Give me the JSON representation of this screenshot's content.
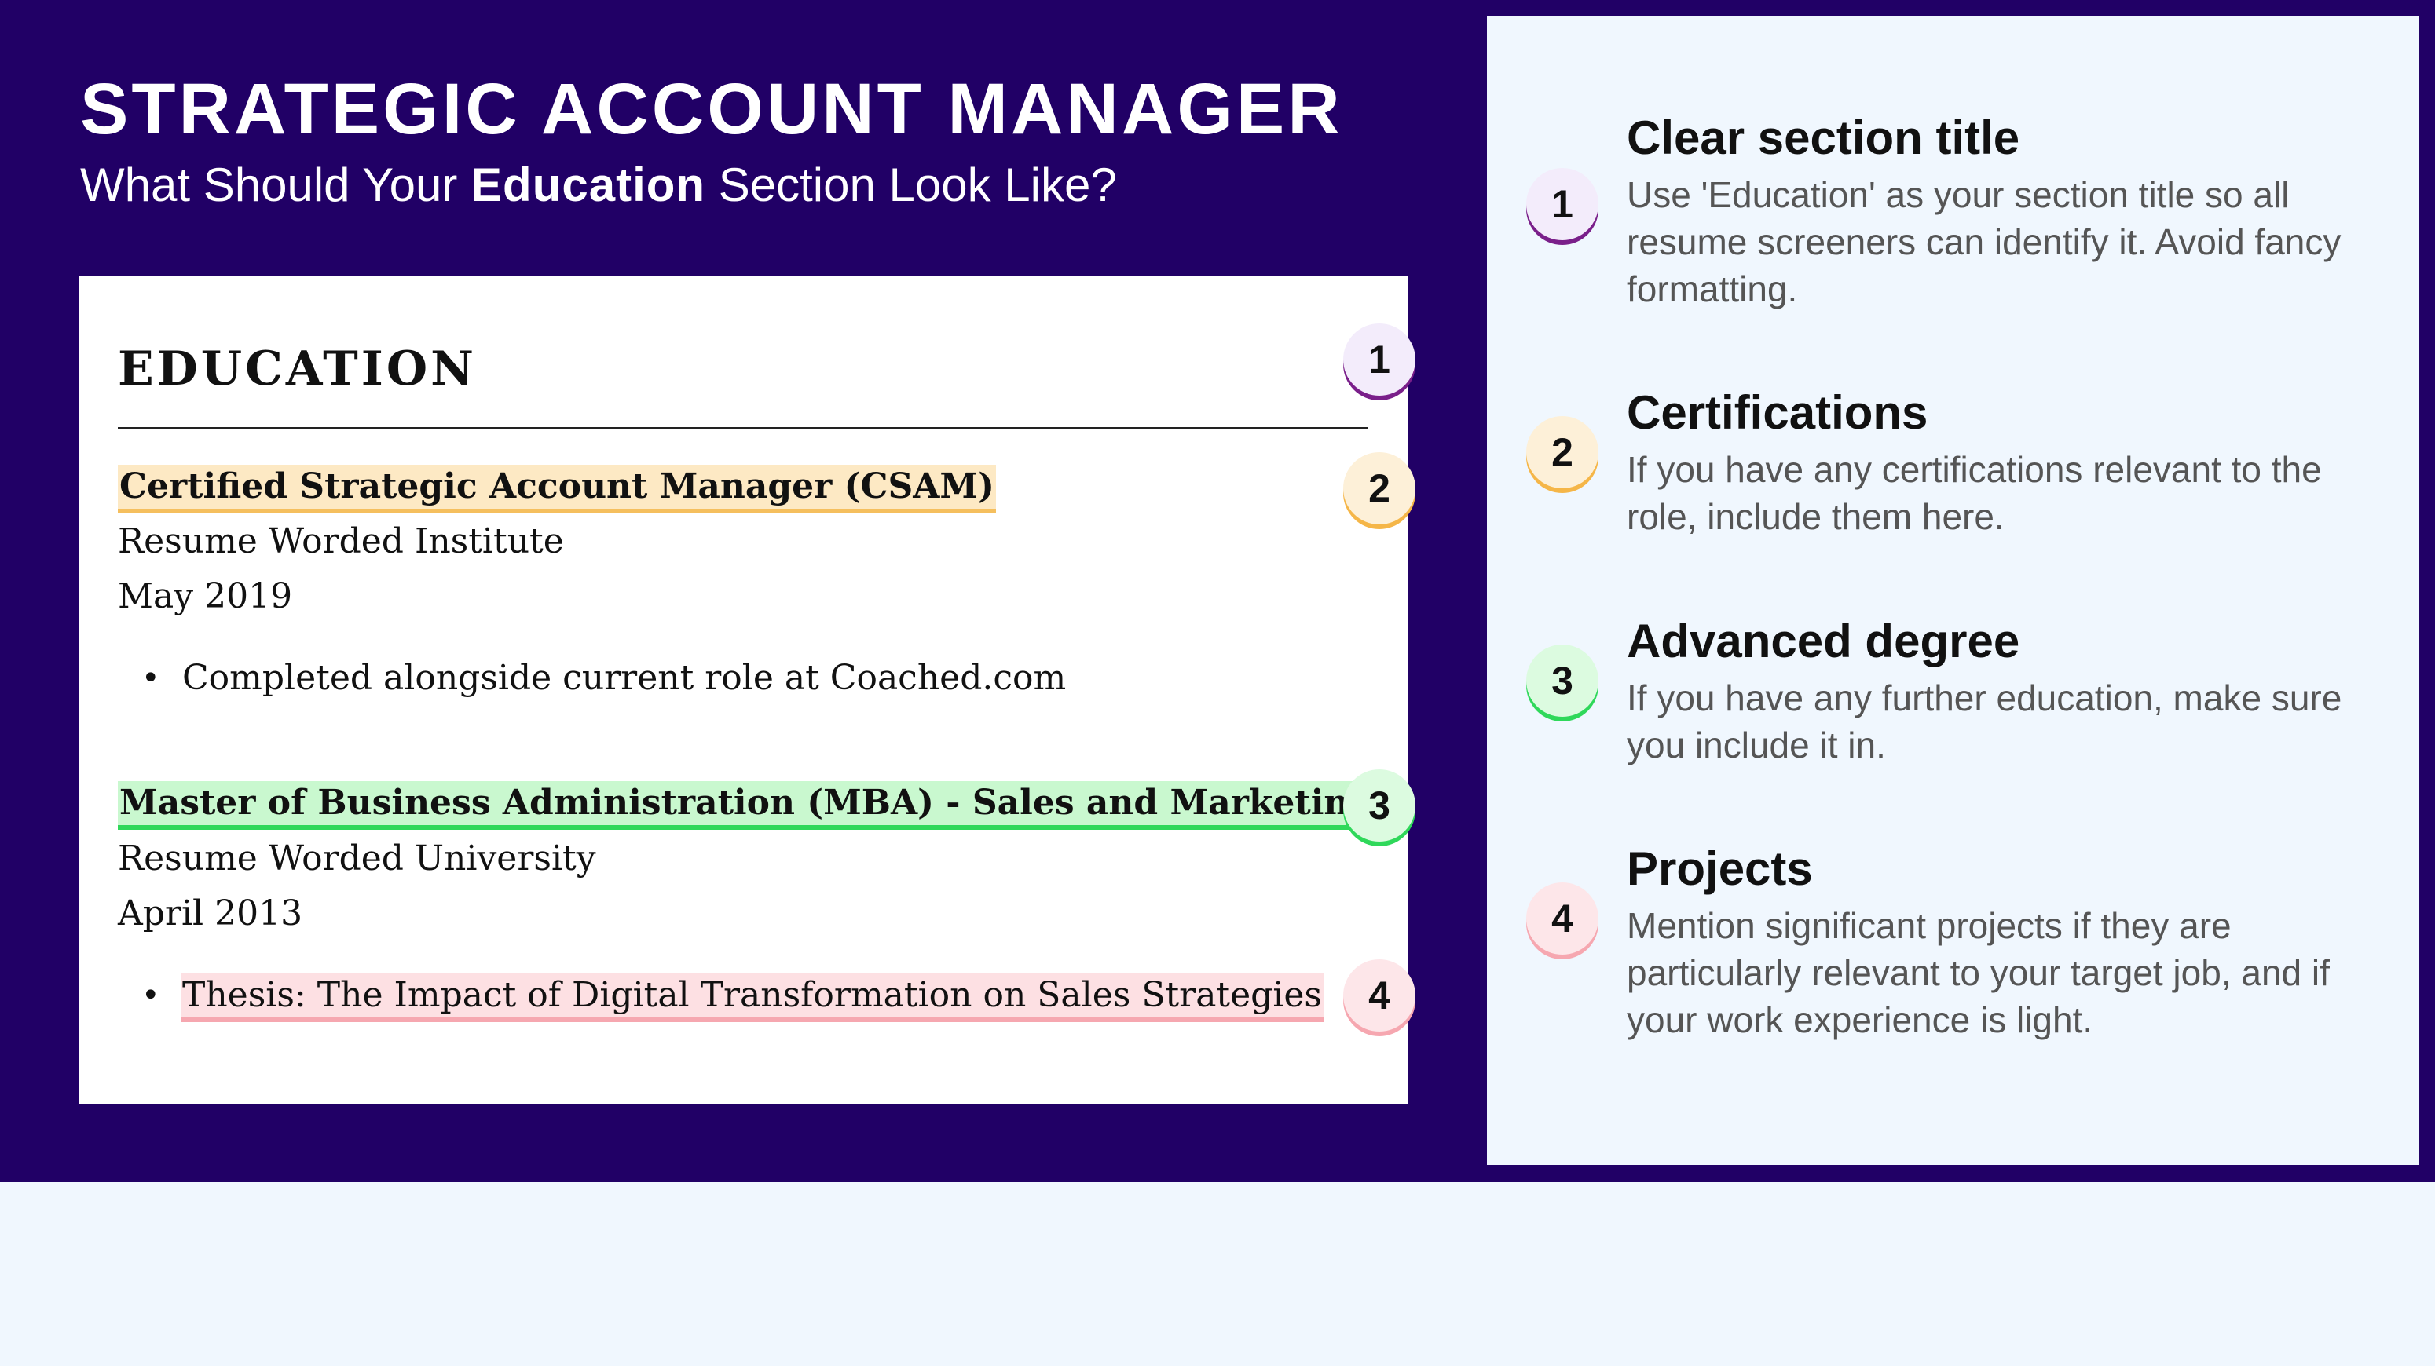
{
  "header": {
    "title": "STRATEGIC ACCOUNT MANAGER",
    "subtitle_before": "What Should Your ",
    "subtitle_bold": "Education",
    "subtitle_after": " Section Look Like?"
  },
  "resume": {
    "section_title": "EDUCATION",
    "entries": [
      {
        "title": "Certified Strategic Account Manager (CSAM)",
        "institution": "Resume Worded Institute",
        "date": "May 2019",
        "bullet": "Completed alongside current role at Coached.com"
      },
      {
        "title": "Master of Business Administration (MBA) - Sales and Marketing",
        "institution": "Resume Worded University",
        "date": "April 2013",
        "bullet": "Thesis: The Impact of Digital Transformation on Sales Strategies"
      }
    ],
    "bullet_glyph": "•",
    "badges": [
      "1",
      "2",
      "3",
      "4"
    ]
  },
  "tips": [
    {
      "number": "1",
      "heading": "Clear section title",
      "text": "Use 'Education' as your section title so all resume screeners can identify it. Avoid fancy formatting."
    },
    {
      "number": "2",
      "heading": "Certifications",
      "text": "If you have any certifications relevant to the role, include them here."
    },
    {
      "number": "3",
      "heading": "Advanced degree",
      "text": "If you have any further education, make sure you include it in."
    },
    {
      "number": "4",
      "heading": "Projects",
      "text": "Mention significant projects if they are particularly relevant to your target job, and if your work experience is light."
    }
  ],
  "colors": {
    "banner": "#210066",
    "panel": "#f0f7fe",
    "badge1_accent": "#7a1f8a",
    "badge2_accent": "#f5b648",
    "badge3_accent": "#2fd85a",
    "badge4_accent": "#f6a7b0"
  }
}
